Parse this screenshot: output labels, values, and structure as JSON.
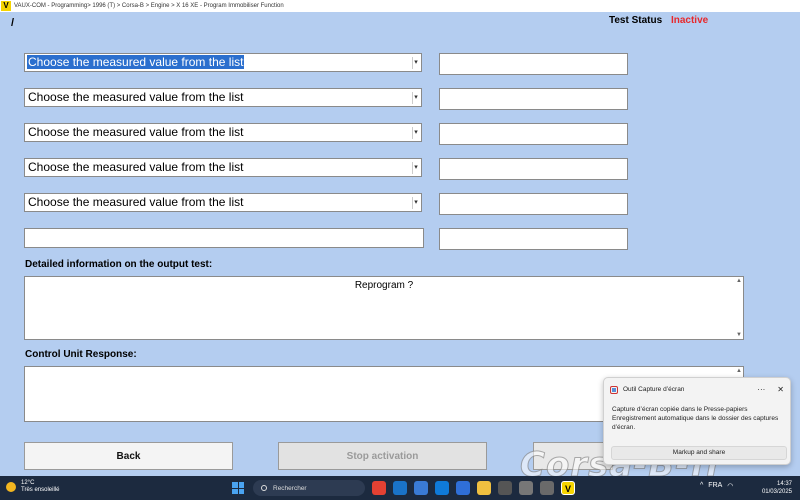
{
  "window": {
    "logo": "V",
    "title": "VAUX-COM - Programming> 1996 (T) > Corsa-B > Engine > X 16 XE - Program Immobiliser Function"
  },
  "header": {
    "slash": "/",
    "status_label": "Test Status",
    "status_value": "Inactive",
    "status_color": "#e8282b"
  },
  "selects": [
    {
      "value": "Choose the measured value from the list"
    },
    {
      "value": "Choose the measured value from the list"
    },
    {
      "value": "Choose the measured value from the list"
    },
    {
      "value": "Choose the measured value from the list"
    },
    {
      "value": "Choose the measured value from the list"
    }
  ],
  "detail": {
    "label": "Detailed information on the output test:",
    "text": "Reprogram ?"
  },
  "response": {
    "label": "Control Unit Response:"
  },
  "buttons": {
    "back": "Back",
    "stop": "Stop activation"
  },
  "notification": {
    "title": "Outil Capture d’écran",
    "more": "···",
    "close": "✕",
    "body": "Capture d’écran copiée dans le Presse-papiers Enregistrement automatique dans le dossier des captures d’écran.",
    "action": "Markup and share"
  },
  "watermark": "Corsa-B-fr",
  "taskbar": {
    "temperature": "12°C",
    "weather": "Très ensoleillé",
    "search_placeholder": "Rechercher",
    "tray_lang": "FRA",
    "time": "14:37",
    "date": "01/03/2025",
    "vaux_icon": "V"
  },
  "colors": {
    "background": "#b4cdf0",
    "selection": "#2b6fce",
    "taskbar": "#1c2a3f"
  }
}
